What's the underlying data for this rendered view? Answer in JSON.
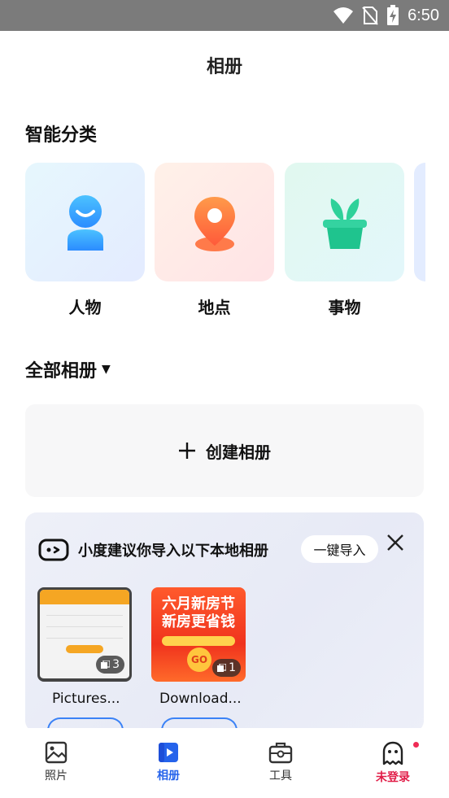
{
  "status_bar": {
    "time": "6:50"
  },
  "page": {
    "title": "相册"
  },
  "smart": {
    "section_title": "智能分类",
    "categories": [
      {
        "label": "人物",
        "icon": "person-icon"
      },
      {
        "label": "地点",
        "icon": "location-pin-icon"
      },
      {
        "label": "事物",
        "icon": "plant-icon"
      }
    ]
  },
  "albums": {
    "section_title": "全部相册",
    "create_label": "创建相册"
  },
  "suggestion": {
    "text": "小度建议你导入以下本地相册",
    "import_label": "一键导入",
    "items": [
      {
        "name": "Pictures...",
        "count": "3"
      },
      {
        "name": "Download...",
        "count": "1"
      }
    ],
    "promo": {
      "line1": "六月新房节",
      "line2": "新房更省钱",
      "go": "GO"
    }
  },
  "nav": {
    "items": [
      {
        "label": "照片",
        "icon": "photo-icon"
      },
      {
        "label": "相册",
        "icon": "album-icon",
        "active": true
      },
      {
        "label": "工具",
        "icon": "toolbox-icon"
      },
      {
        "label": "未登录",
        "icon": "ghost-icon"
      }
    ]
  },
  "colors": {
    "accent": "#2563eb",
    "alert": "#e11d48"
  }
}
